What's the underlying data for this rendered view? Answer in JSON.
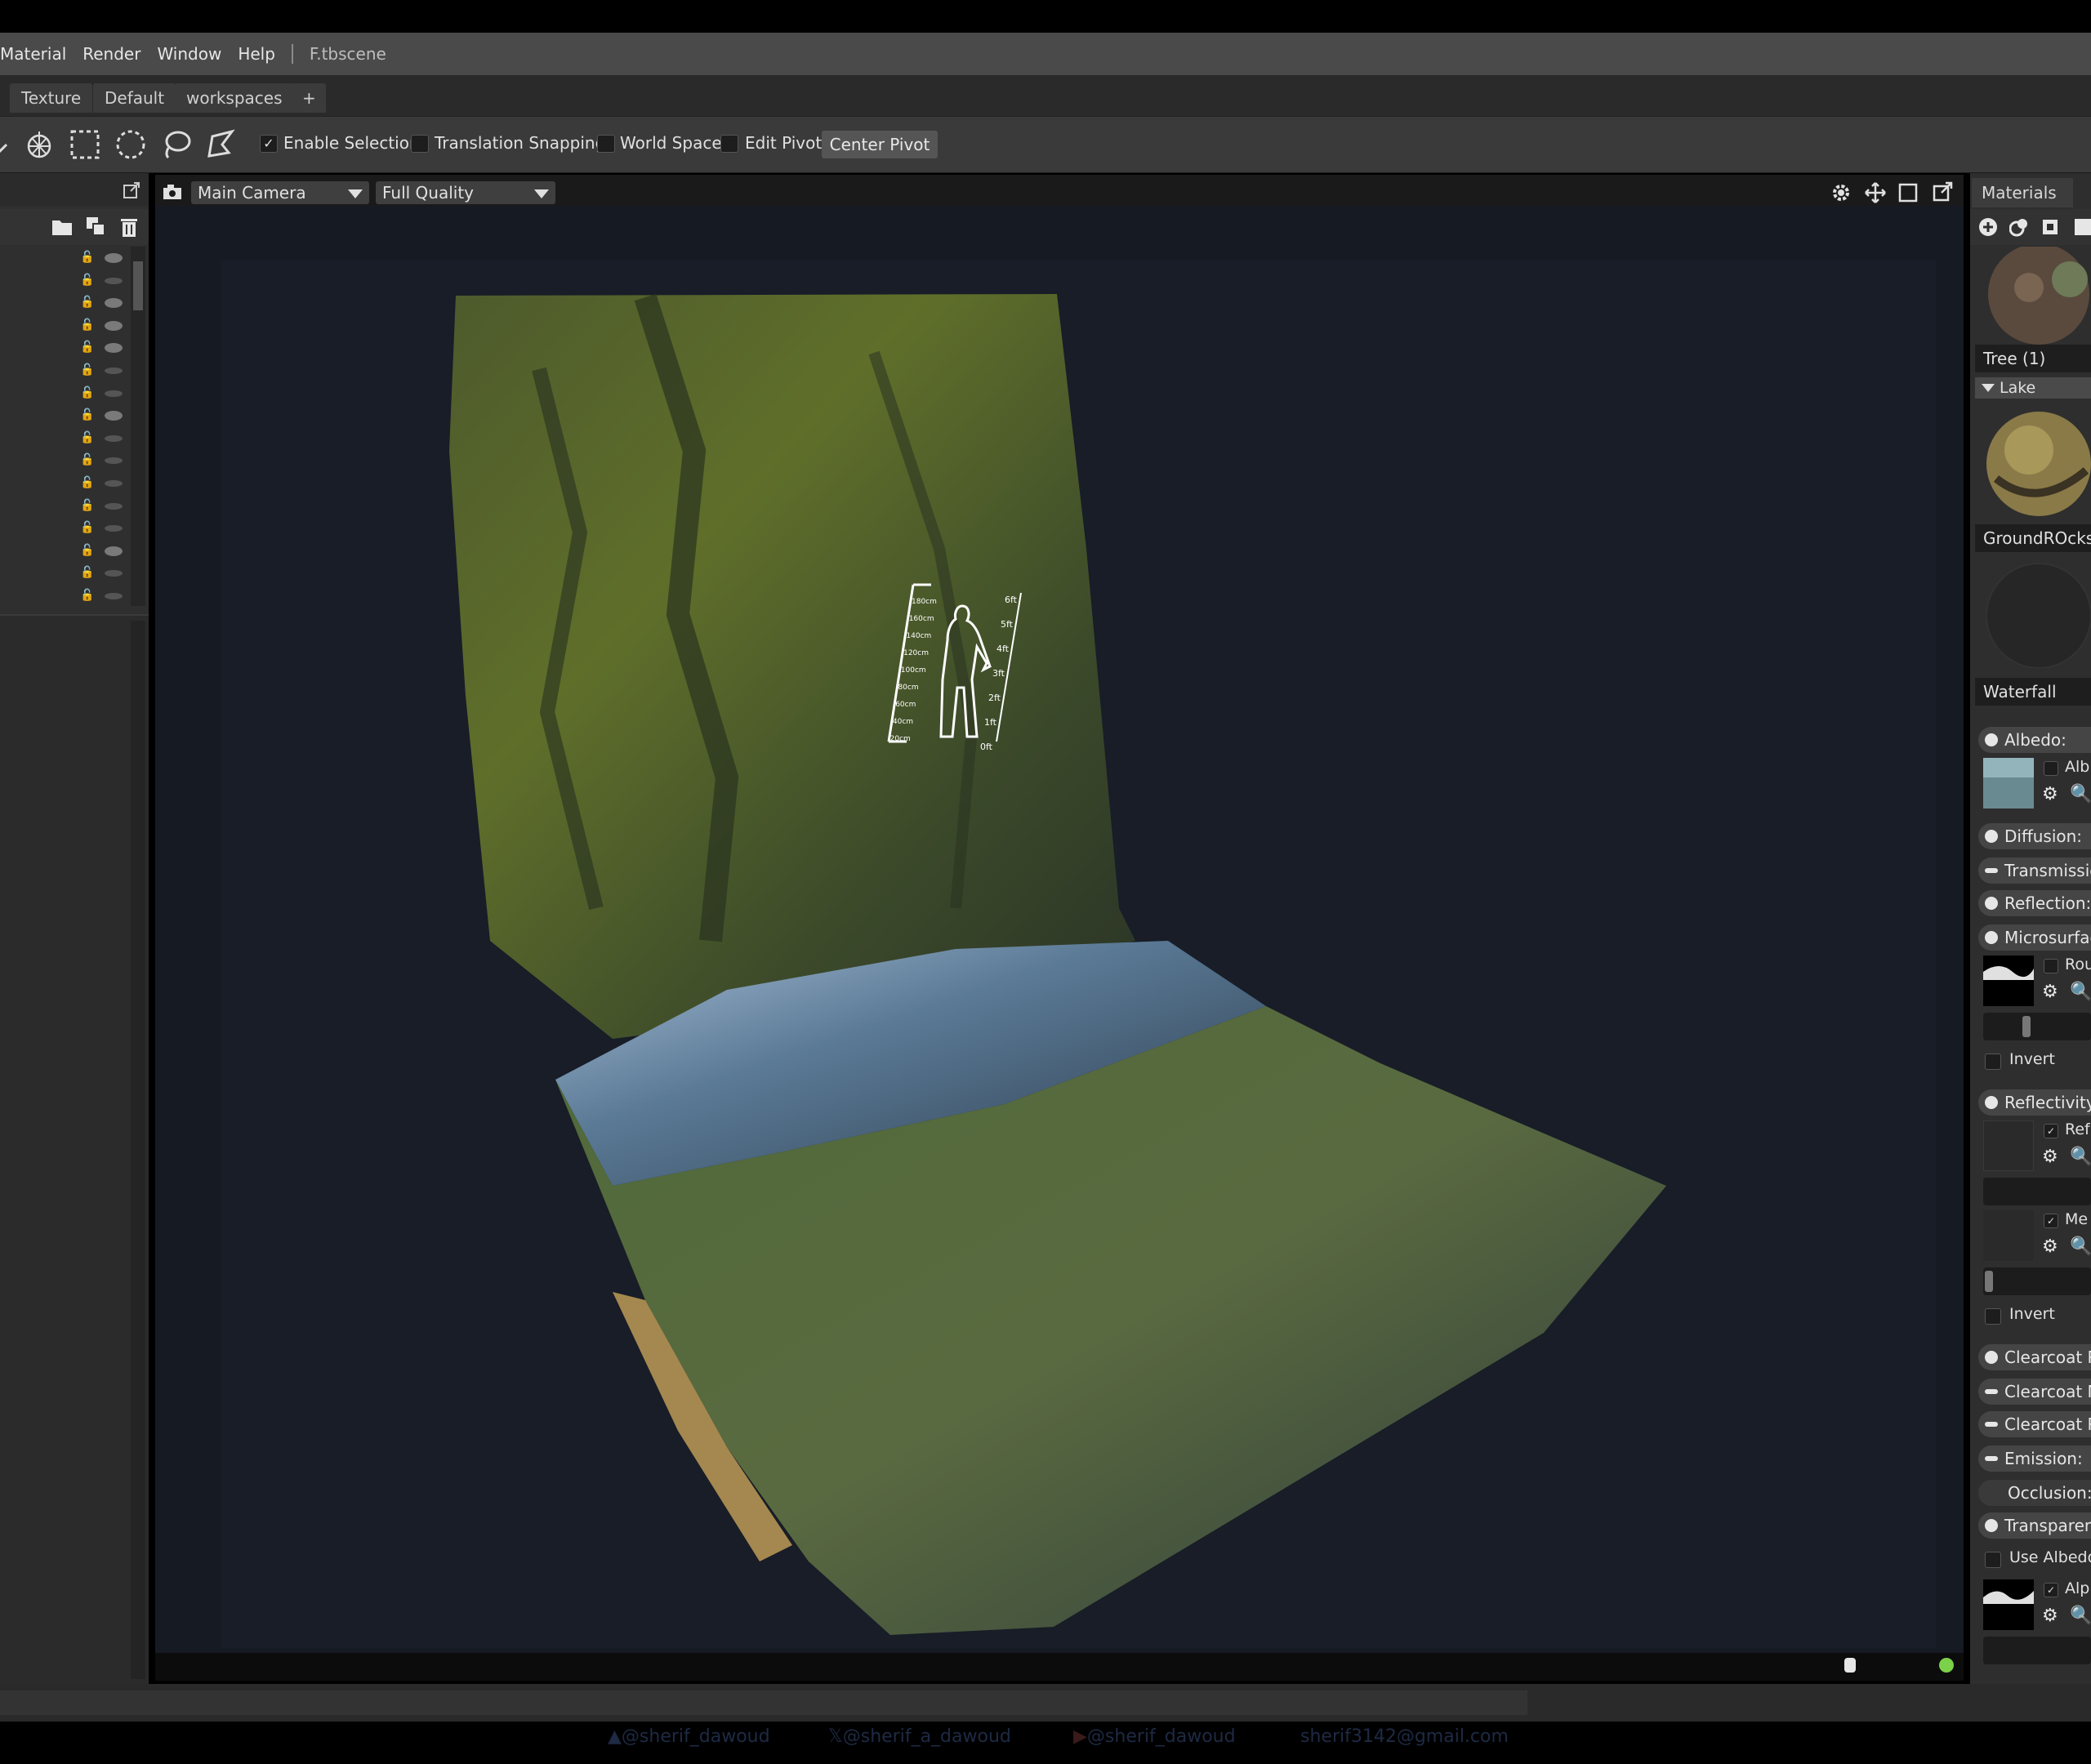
{
  "menu": {
    "items": [
      "Material",
      "Render",
      "Window",
      "Help"
    ],
    "file_name": "F.tbscene"
  },
  "tabs": [
    "Texture",
    "Default",
    "workspaces",
    "+"
  ],
  "toolbar": {
    "enable_selection": {
      "label": "Enable Selection",
      "checked": true
    },
    "translation_snapping": {
      "label": "Translation Snapping",
      "checked": false
    },
    "world_space": {
      "label": "World Space",
      "checked": false
    },
    "edit_pivot": {
      "label": "Edit Pivot",
      "checked": false
    },
    "center_pivot": "Center Pivot",
    "check_mark": "✓"
  },
  "viewport": {
    "camera": "Main Camera",
    "quality": "Full Quality"
  },
  "materials": {
    "tab_label": "Materials",
    "items": [
      {
        "name": "Tree (1)"
      },
      {
        "name": "GroundROcks"
      },
      {
        "name": "Waterfall"
      }
    ],
    "group": "Lake"
  },
  "properties": {
    "albedo": "Albedo:",
    "albedo_map": "Alb",
    "diffusion": "Diffusion:",
    "transmission": "Transmissio",
    "reflection": "Reflection:",
    "microsurface": "Microsurfac",
    "roughness_map": "Rou",
    "invert_1": "Invert",
    "reflectivity": "Reflectivity:",
    "reflectivity_map": "Ref",
    "metalness_map": "Me",
    "invert_2": "Invert",
    "clearcoat_1": "Clearcoat R",
    "clearcoat_2": "Clearcoat M",
    "clearcoat_3": "Clearcoat R",
    "emission": "Emission:",
    "occlusion": "Occlusion:",
    "transparency": "Transparenc",
    "use_albedo": "Use Albedo",
    "alpha_map": "Alp"
  },
  "scale_ruler": {
    "left_ticks": [
      "180cm",
      "160cm",
      "140cm",
      "120cm",
      "100cm",
      "80cm",
      "60cm",
      "40cm",
      "20cm"
    ],
    "right_ticks": [
      "6ft",
      "5ft",
      "4ft",
      "3ft",
      "2ft",
      "1ft",
      "0ft"
    ]
  },
  "credits": [
    "@sherif_dawoud",
    "@sherif_a_dawoud",
    "@sherif_dawoud",
    "sherif3142@gmail.com"
  ],
  "colors": {
    "accent_green": "#7cd14a",
    "panel_bg": "#2e2e2e",
    "menu_bg": "#4a4a4a"
  }
}
